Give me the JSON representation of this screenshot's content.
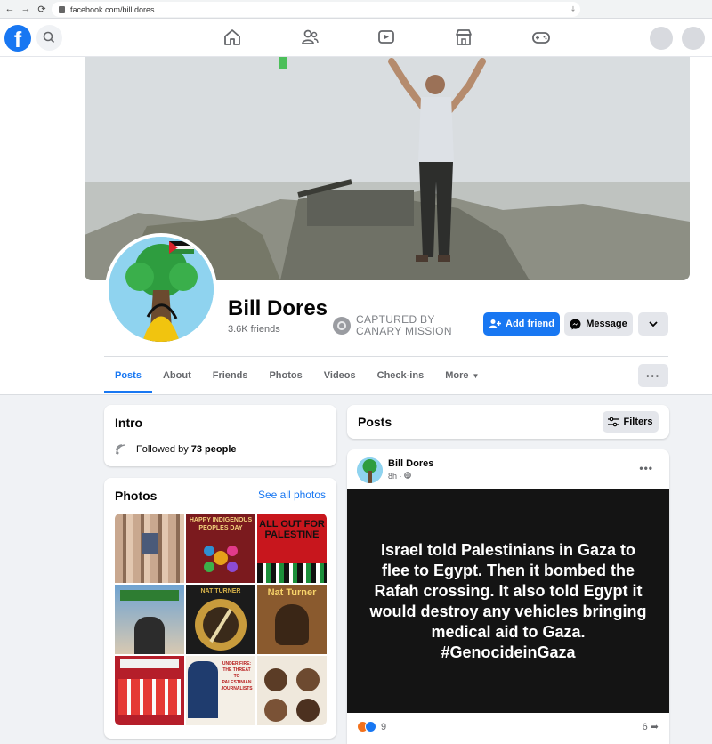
{
  "browser": {
    "url": "facebook.com/bill.dores"
  },
  "topbar": {
    "logo_letter": "f",
    "nav_icons": [
      "home-icon",
      "friends-icon",
      "video-icon",
      "marketplace-icon",
      "gaming-icon"
    ]
  },
  "profile": {
    "name": "Bill Dores",
    "friends_count": "3.6K friends",
    "watermark_line1": "CAPTURED BY",
    "watermark_line2": "CANARY MISSION",
    "add_friend_label": "Add friend",
    "message_label": "Message",
    "dropdown_label": "⌄",
    "tabs": [
      {
        "label": "Posts",
        "active": true
      },
      {
        "label": "About",
        "active": false
      },
      {
        "label": "Friends",
        "active": false
      },
      {
        "label": "Photos",
        "active": false
      },
      {
        "label": "Videos",
        "active": false
      },
      {
        "label": "Check-ins",
        "active": false
      },
      {
        "label": "More",
        "active": false
      }
    ],
    "more_menu_label": "···"
  },
  "intro": {
    "title": "Intro",
    "followed_by_prefix": "Followed by",
    "followed_by_count": "73 people"
  },
  "photos": {
    "title": "Photos",
    "see_all_label": "See all photos",
    "tiles": [
      {
        "text": ""
      },
      {
        "text": "HAPPY INDIGENOUS PEOPLES DAY"
      },
      {
        "text": "ALL OUT FOR PALESTINE"
      },
      {
        "text": ""
      },
      {
        "text": "NAT TURNER"
      },
      {
        "text": "Nat Turner"
      },
      {
        "text": ""
      },
      {
        "text": "UNDER FIRE: THE THREAT TO PALESTINIAN JOURNALISTS"
      },
      {
        "text": ""
      }
    ]
  },
  "posts": {
    "title": "Posts",
    "filters_label": "Filters",
    "items": [
      {
        "author": "Bill Dores",
        "time": "8h",
        "privacy_icon": "globe-icon",
        "body_text": "Israel told Palestinians in Gaza to flee to Egypt. Then it bombed the Rafah crossing. It also told Egypt it would destroy any vehicles bringing medical aid to Gaza.",
        "hashtag": "#GenocideinGaza",
        "reaction_count": "9",
        "share_count": "6",
        "reaction_icons": [
          "angry-react-icon",
          "like-react-icon"
        ]
      }
    ]
  },
  "colors": {
    "brand_blue": "#1877f2",
    "page_bg": "#f0f2f5",
    "post_bg": "#141414"
  }
}
